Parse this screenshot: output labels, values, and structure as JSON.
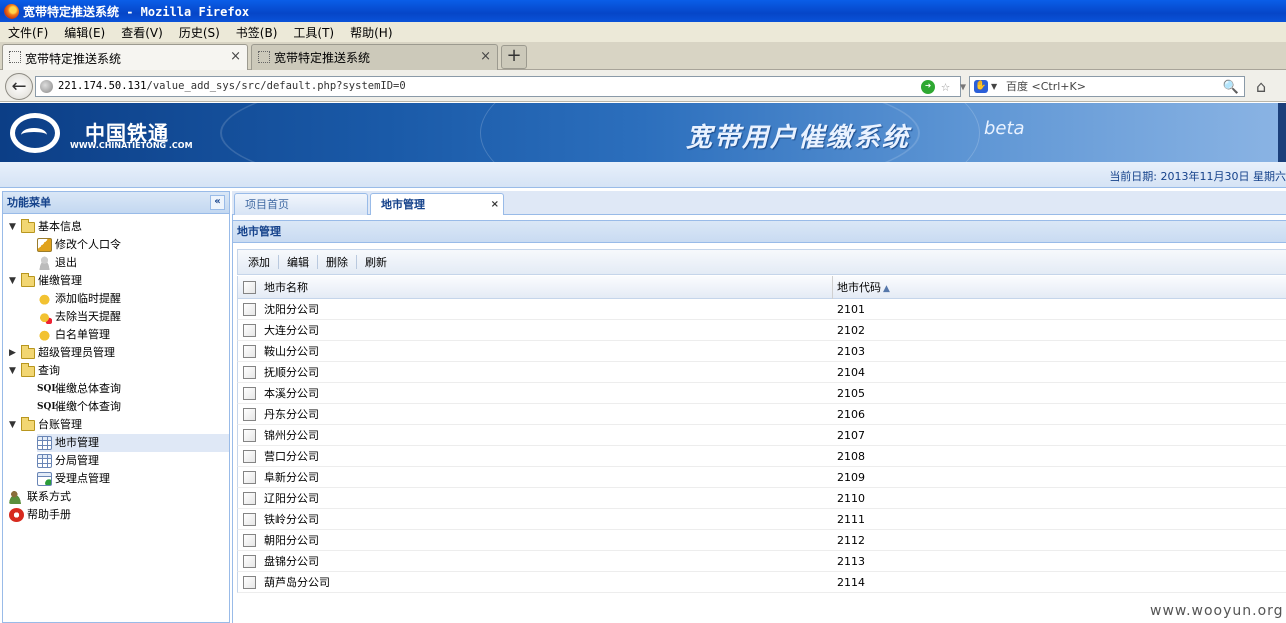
{
  "window": {
    "title": "宽带特定推送系统 - Mozilla Firefox"
  },
  "menubar": [
    "文件(F)",
    "编辑(E)",
    "查看(V)",
    "历史(S)",
    "书签(B)",
    "工具(T)",
    "帮助(H)"
  ],
  "browser_tabs": [
    {
      "label": "宽带特定推送系统",
      "close": "×"
    },
    {
      "label": "宽带特定推送系统",
      "close": "×"
    }
  ],
  "new_tab": "+",
  "navbar": {
    "url_host": "221.174.50.131",
    "url_path": "/value_add_sys/src/default.php?systemID=0",
    "search_placeholder": "百度 <Ctrl+K>"
  },
  "banner": {
    "brand_cn": "中国铁通",
    "brand_en": "WWW.CHINATIETONG .COM",
    "app_title": "宽带用户催缴系统",
    "app_beta": "beta"
  },
  "datebar": {
    "text": "当前日期: 2013年11月30日 星期六"
  },
  "sidebar": {
    "title": "功能菜单",
    "collapse": "«",
    "items": [
      {
        "label": "基本信息",
        "type": "folder",
        "arrow": "▼"
      },
      {
        "label": "修改个人口令",
        "type": "edit"
      },
      {
        "label": "退出",
        "type": "user"
      },
      {
        "label": "催缴管理",
        "type": "folder",
        "arrow": "▼"
      },
      {
        "label": "添加临时提醒",
        "type": "bell"
      },
      {
        "label": "去除当天提醒",
        "type": "bellx"
      },
      {
        "label": "白名单管理",
        "type": "bell"
      },
      {
        "label": "超级管理员管理",
        "type": "folder",
        "arrow": "▶"
      },
      {
        "label": "查询",
        "type": "folder",
        "arrow": "▼"
      },
      {
        "label": "催缴总体查询",
        "type": "sql",
        "icon_text": "SQL"
      },
      {
        "label": "催缴个体查询",
        "type": "sql",
        "icon_text": "SQL"
      },
      {
        "label": "台账管理",
        "type": "folder",
        "arrow": "▼"
      },
      {
        "label": "地市管理",
        "type": "grid",
        "selected": true
      },
      {
        "label": "分局管理",
        "type": "grid"
      },
      {
        "label": "受理点管理",
        "type": "gridplus"
      },
      {
        "label": "联系方式",
        "type": "people"
      },
      {
        "label": "帮助手册",
        "type": "help"
      }
    ]
  },
  "content_tabs": [
    {
      "label": "项目首页"
    },
    {
      "label": "地市管理",
      "close": "×"
    }
  ],
  "panel": {
    "title": "地市管理",
    "toolbar": [
      "添加",
      "编辑",
      "删除",
      "刷新"
    ],
    "columns": [
      "地市名称",
      "地市代码"
    ],
    "sort_indicator": "▲",
    "rows": [
      [
        "沈阳分公司",
        "2101"
      ],
      [
        "大连分公司",
        "2102"
      ],
      [
        "鞍山分公司",
        "2103"
      ],
      [
        "抚顺分公司",
        "2104"
      ],
      [
        "本溪分公司",
        "2105"
      ],
      [
        "丹东分公司",
        "2106"
      ],
      [
        "锦州分公司",
        "2107"
      ],
      [
        "营口分公司",
        "2108"
      ],
      [
        "阜新分公司",
        "2109"
      ],
      [
        "辽阳分公司",
        "2110"
      ],
      [
        "铁岭分公司",
        "2111"
      ],
      [
        "朝阳分公司",
        "2112"
      ],
      [
        "盘锦分公司",
        "2113"
      ],
      [
        "葫芦岛分公司",
        "2114"
      ]
    ]
  },
  "watermark": "www.wooyun.org",
  "colors": {
    "accent": "#15428b",
    "header_bg": "#dfe8f6",
    "border": "#99bbe8"
  }
}
